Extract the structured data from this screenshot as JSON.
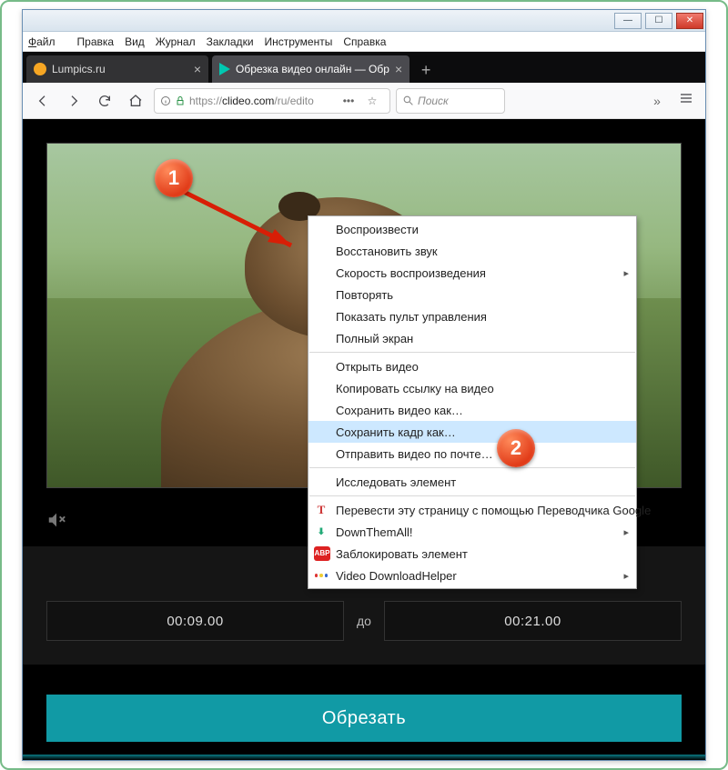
{
  "menubar": {
    "file": "Файл",
    "edit": "Правка",
    "view": "Вид",
    "history": "Журнал",
    "bookmarks": "Закладки",
    "tools": "Инструменты",
    "help": "Справка"
  },
  "tabs": [
    {
      "title": "Lumpics.ru"
    },
    {
      "title": "Обрезка видео онлайн — Обр"
    }
  ],
  "url": {
    "prefix": "https://",
    "host": "clideo.com",
    "path": "/ru/edito"
  },
  "search": {
    "placeholder": "Поиск"
  },
  "editor": {
    "time_from": "00:09.00",
    "time_sep": "до",
    "time_to": "00:21.00",
    "cut_label": "Обрезать"
  },
  "context_menu": {
    "items": [
      {
        "label": "Воспроизвести"
      },
      {
        "label": "Восстановить звук"
      },
      {
        "label": "Скорость воспроизведения",
        "submenu": true
      },
      {
        "label": "Повторять"
      },
      {
        "label": "Показать пульт управления"
      },
      {
        "label": "Полный экран"
      },
      {
        "sep": true
      },
      {
        "label": "Открыть видео"
      },
      {
        "label": "Копировать ссылку на видео"
      },
      {
        "label": "Сохранить видео как…"
      },
      {
        "label": "Сохранить кадр как…",
        "highlight": true
      },
      {
        "label": "Отправить видео по почте…"
      },
      {
        "sep": true
      },
      {
        "label": "Исследовать элемент"
      },
      {
        "sep": true
      },
      {
        "label": "Перевести эту страницу с помощью Переводчика Google",
        "icon": "t"
      },
      {
        "label": "DownThemAll!",
        "submenu": true,
        "icon": "dta"
      },
      {
        "label": "Заблокировать элемент",
        "icon": "abp"
      },
      {
        "label": "Video DownloadHelper",
        "submenu": true,
        "icon": "vdh"
      }
    ]
  },
  "callouts": {
    "one": "1",
    "two": "2"
  }
}
